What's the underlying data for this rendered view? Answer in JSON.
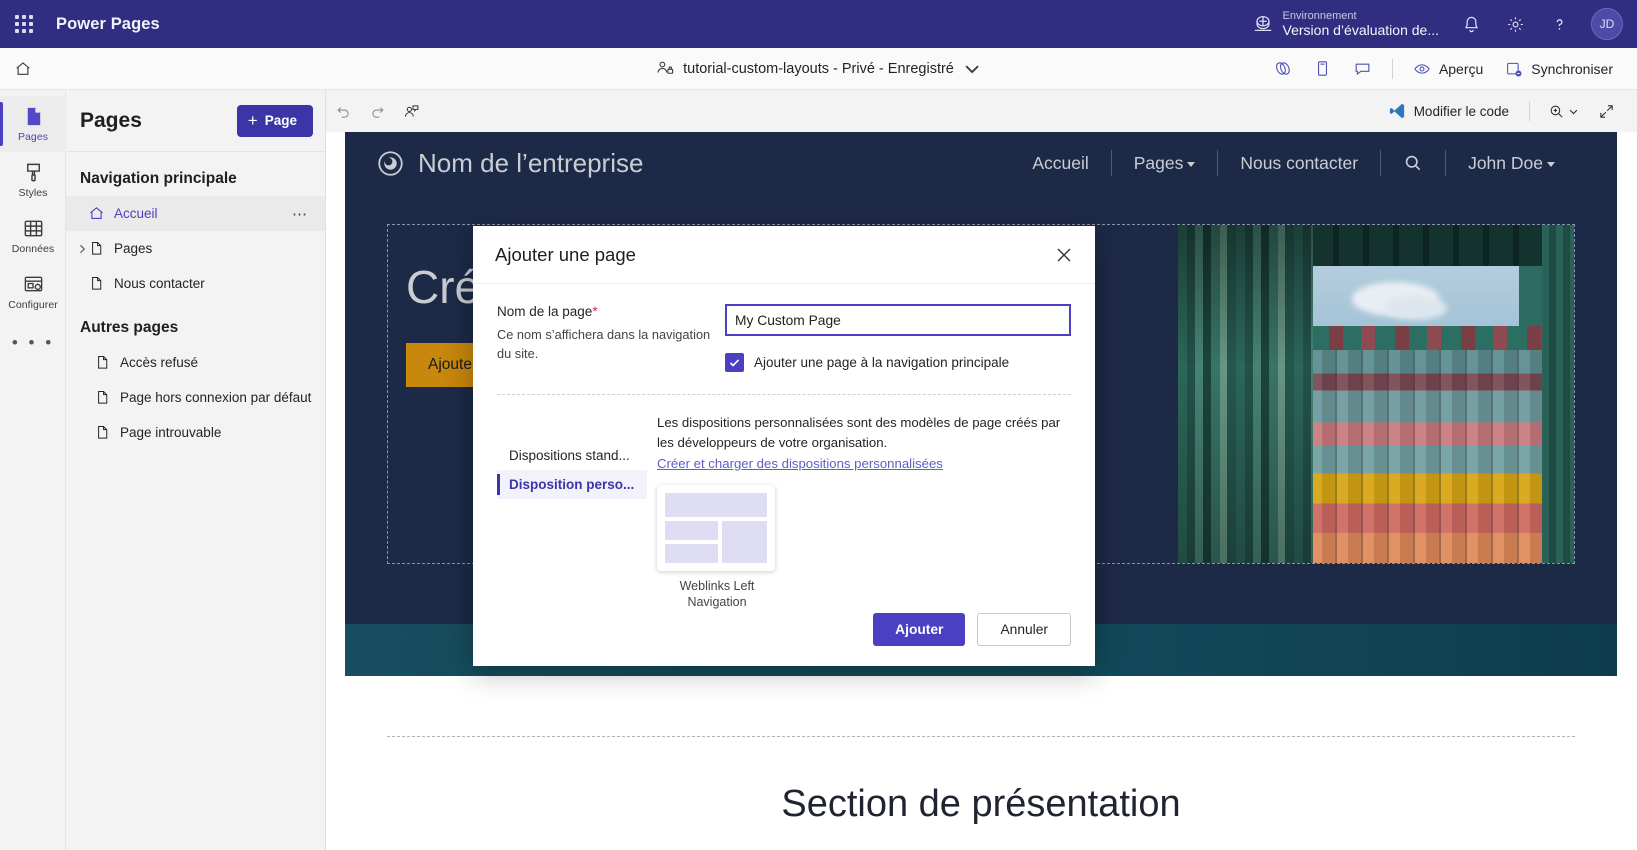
{
  "suite": {
    "waffle_icon": "app-launcher-icon",
    "title": "Power Pages",
    "environment_label": "Environnement",
    "environment_value": "Version d’évaluation de...",
    "environment_icon": "globe-icon",
    "notifications_icon": "bell-icon",
    "settings_icon": "gear-icon",
    "help_icon": "question-icon",
    "avatar_initials": "JD"
  },
  "commandbar": {
    "home_icon": "home-icon",
    "site_name": "tutorial-custom-layouts - Privé - Enregistré",
    "site_icon": "people-lock-icon",
    "chevron_icon": "chevron-down-icon",
    "icons": [
      "theme-icon",
      "device-icon",
      "feedback-icon"
    ],
    "preview_label": "Aperçu",
    "preview_icon": "eye-icon",
    "sync_label": "Synchroniser",
    "sync_icon": "sync-icon"
  },
  "rail": {
    "items": [
      {
        "label": "Pages",
        "icon": "pages-icon",
        "active": true
      },
      {
        "label": "Styles",
        "icon": "brush-icon",
        "active": false
      },
      {
        "label": "Données",
        "icon": "table-icon",
        "active": false
      },
      {
        "label": "Configurer",
        "icon": "configure-icon",
        "active": false
      }
    ],
    "more_label": "• • •"
  },
  "pages_panel": {
    "title": "Pages",
    "add_button": "Page",
    "add_button_plus": "+",
    "group_main": "Navigation principale",
    "group_other": "Autres pages",
    "main_items": [
      {
        "label": "Accueil",
        "icon": "home-icon",
        "selected": true,
        "expandable": false,
        "overflow": "…"
      },
      {
        "label": "Pages",
        "icon": "file-icon",
        "selected": false,
        "expandable": true
      },
      {
        "label": "Nous contacter",
        "icon": "file-icon",
        "selected": false,
        "expandable": false
      }
    ],
    "other_items": [
      {
        "label": "Accès refusé",
        "icon": "file-icon"
      },
      {
        "label": "Page hors connexion par défaut",
        "icon": "file-icon"
      },
      {
        "label": "Page introuvable",
        "icon": "file-icon"
      }
    ]
  },
  "canvas_toolbar": {
    "undo_icon": "undo-icon",
    "redo_icon": "redo-icon",
    "collab_icon": "collaborate-icon",
    "edit_code_label": "Modifier le code",
    "edit_code_icon": "vscode-icon",
    "zoom_icon": "zoom-in-icon",
    "zoom_chevron_icon": "chevron-down-icon",
    "expand_icon": "fullscreen-icon"
  },
  "site_preview": {
    "brand_name": "Nom de l’entreprise",
    "brand_icon": "circle-logo-icon",
    "nav": [
      {
        "label": "Accueil",
        "dropdown": false
      },
      {
        "label": "Pages",
        "dropdown": true
      },
      {
        "label": "Nous contacter",
        "dropdown": false
      }
    ],
    "search_icon": "search-icon",
    "user_label": "John Doe",
    "hero_heading": "Créez votre message d’appel",
    "hero_button": "Ajouter un appel",
    "section_title": "Section de présentation"
  },
  "dialog": {
    "title": "Ajouter une page",
    "close_icon": "close-icon",
    "name_label": "Nom de la page",
    "name_required_mark": "*",
    "name_help": "Ce nom s’affichera dans la navigation du site.",
    "name_value": "My Custom Page",
    "name_placeholder": "Nom de la page",
    "checkbox_label": "Ajouter une page à la navigation principale",
    "checkbox_checked": true,
    "checkbox_icon": "checkmark-icon",
    "tabs": [
      {
        "label": "Dispositions stand...",
        "active": false
      },
      {
        "label": "Disposition perso...",
        "active": true
      }
    ],
    "layout_description": "Les dispositions personnalisées sont des modèles de page créés par les développeurs de votre organisation.",
    "layout_link": "Créer et charger des dispositions personnalisées",
    "templates": [
      {
        "name": "Weblinks Left Navigation",
        "selected": false
      }
    ],
    "add_button": "Ajouter",
    "cancel_button": "Annuler"
  },
  "colors": {
    "suite_bar": "#312e81",
    "accent": "#4b3fc4",
    "primary_button": "#3b35a8",
    "site_header": "#1d2a47",
    "hero_button": "#c8870d",
    "required": "#c4314b",
    "link": "#5b5fc7"
  }
}
